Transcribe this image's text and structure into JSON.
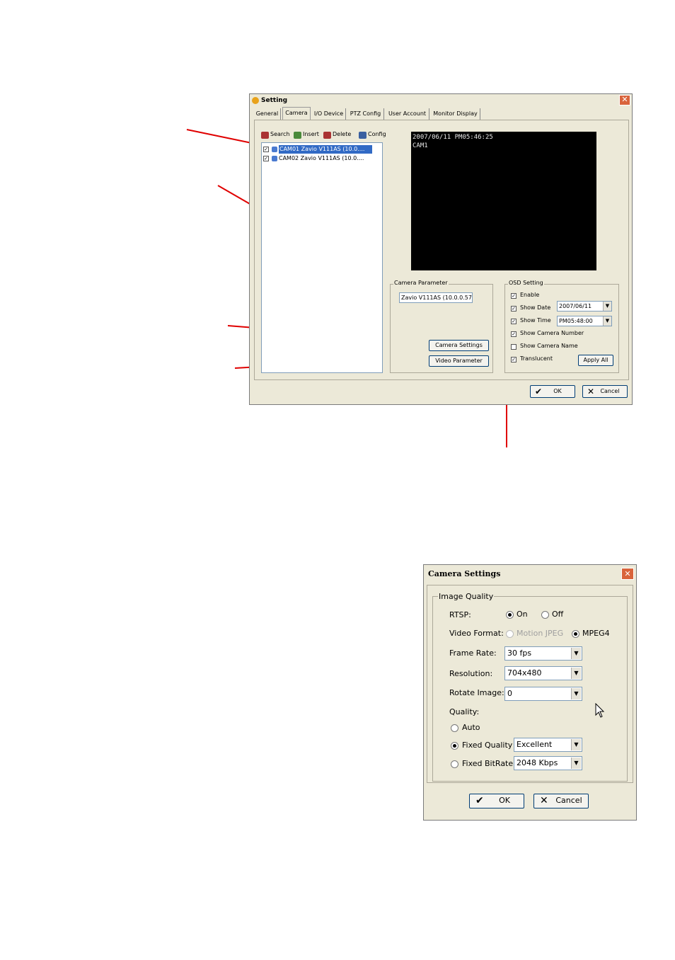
{
  "setting_window": {
    "title": "Setting",
    "tabs": [
      "General",
      "Camera",
      "I/O Device",
      "PTZ Config",
      "User Account",
      "Monitor Display"
    ],
    "toolbar": {
      "search": "Search",
      "insert": "Insert",
      "delete": "Delete",
      "config": "Config"
    },
    "camera_list": [
      {
        "label": "CAM01 Zavio V111AS (10.0....",
        "checked": true,
        "selected": true
      },
      {
        "label": "CAM02 Zavio V111AS (10.0....",
        "checked": true,
        "selected": false
      }
    ],
    "preview": {
      "timestamp": "2007/06/11 PM05:46:25",
      "camera": "CAM1"
    },
    "camera_parameter": {
      "legend": "Camera Parameter",
      "value": "Zavio V111AS (10.0.0.57",
      "camera_settings_button": "Camera Settings",
      "video_parameter_button": "Video Parameter"
    },
    "osd_setting": {
      "legend": "OSD Setting",
      "enable": "Enable",
      "show_date": "Show Date",
      "date_value": "2007/06/11",
      "show_time": "Show Time",
      "time_value": "PM05:48:00",
      "show_camera_number": "Show Camera Number",
      "show_camera_name": "Show Camera Name",
      "translucent": "Translucent",
      "apply_all": "Apply All"
    },
    "ok": "OK",
    "cancel": "Cancel"
  },
  "camera_settings_dialog": {
    "title": "Camera Settings",
    "group_legend": "Image Quality",
    "rtsp_label": "RTSP:",
    "rtsp_on": "On",
    "rtsp_off": "Off",
    "video_format_label": "Video Format:",
    "video_format_mjpeg": "Motion JPEG",
    "video_format_mpeg4": "MPEG4",
    "frame_rate_label": "Frame Rate:",
    "frame_rate_value": "30 fps",
    "resolution_label": "Resolution:",
    "resolution_value": "704x480",
    "rotate_label": "Rotate Image:",
    "rotate_value": "0",
    "quality_label": "Quality:",
    "auto_label": "Auto",
    "fixed_quality_label": "Fixed Quality",
    "fixed_quality_value": "Excellent",
    "fixed_bitrate_label": "Fixed BitRate",
    "fixed_bitrate_value": "2048 Kbps",
    "ok": "OK",
    "cancel": "Cancel"
  },
  "colors": {
    "callout_line": "#e00000",
    "selection": "#316ac5",
    "window_bg": "#ece9d8"
  }
}
